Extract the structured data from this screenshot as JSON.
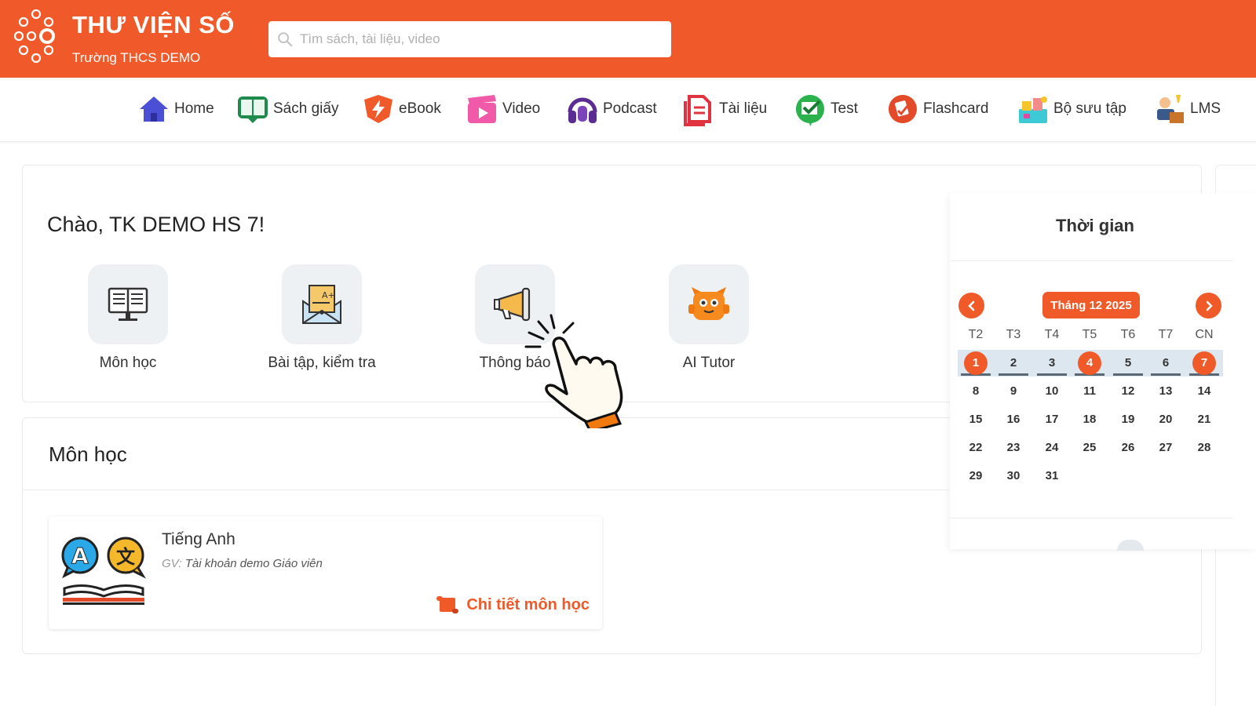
{
  "brand": {
    "title": "THƯ VIỆN SỐ",
    "subtitle": "Trường THCS DEMO",
    "color": "#f05a2b"
  },
  "search": {
    "placeholder": "Tìm sách, tài liệu, video",
    "value": ""
  },
  "nav": {
    "items": [
      {
        "label": "Home",
        "icon": "home-icon"
      },
      {
        "label": "Sách giấy",
        "icon": "book-icon"
      },
      {
        "label": "eBook",
        "icon": "ebook-icon"
      },
      {
        "label": "Video",
        "icon": "video-icon"
      },
      {
        "label": "Podcast",
        "icon": "headphones-icon"
      },
      {
        "label": "Tài liệu",
        "icon": "document-icon"
      },
      {
        "label": "Test",
        "icon": "test-icon"
      },
      {
        "label": "Flashcard",
        "icon": "flashcard-icon"
      },
      {
        "label": "Bộ sưu tập",
        "icon": "collection-icon"
      },
      {
        "label": "LMS",
        "icon": "lms-icon"
      }
    ]
  },
  "welcome": {
    "greeting": "Chào, TK DEMO HS 7!",
    "tiles": [
      {
        "label": "Môn học",
        "icon": "textbook-icon"
      },
      {
        "label": "Bài tập, kiểm tra",
        "icon": "assignment-icon"
      },
      {
        "label": "Thông báo",
        "icon": "megaphone-icon"
      },
      {
        "label": "AI Tutor",
        "icon": "robot-icon"
      }
    ]
  },
  "subjects": {
    "title": "Môn học",
    "course": {
      "name": "Tiếng Anh",
      "teacher_prefix": "GV:",
      "teacher": "Tài khoản demo Giáo viên",
      "detail_link": "Chi tiết môn học"
    }
  },
  "calendar": {
    "title": "Thời gian",
    "month": "Tháng 12 2025",
    "weekdays": [
      "T2",
      "T3",
      "T4",
      "T5",
      "T6",
      "T7",
      "CN"
    ],
    "weeks": [
      [
        "1",
        "2",
        "3",
        "4",
        "5",
        "6",
        "7"
      ],
      [
        "8",
        "9",
        "10",
        "11",
        "12",
        "13",
        "14"
      ],
      [
        "15",
        "16",
        "17",
        "18",
        "19",
        "20",
        "21"
      ],
      [
        "22",
        "23",
        "24",
        "25",
        "26",
        "27",
        "28"
      ],
      [
        "29",
        "30",
        "31"
      ]
    ],
    "highlighted_days": [
      "1",
      "4",
      "7"
    ],
    "accent": "#ef5a28"
  }
}
